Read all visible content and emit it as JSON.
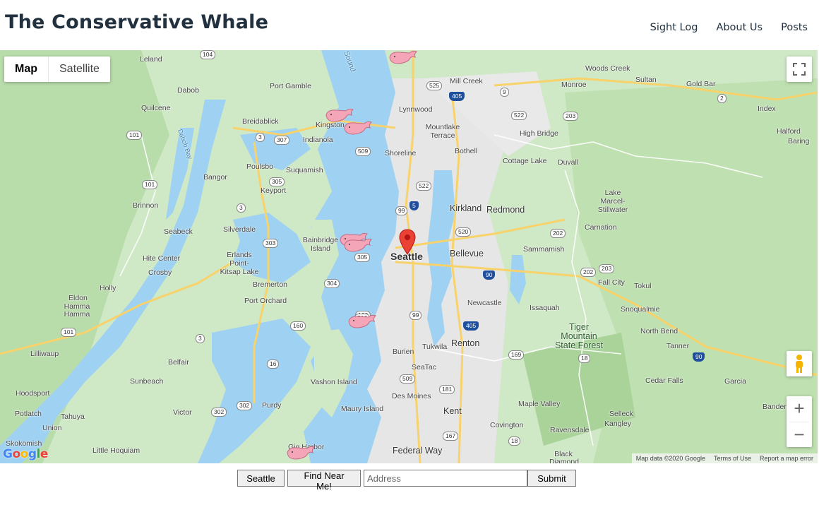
{
  "header": {
    "title": "The Conservative Whale",
    "nav": [
      "Sight Log",
      "About Us",
      "Posts"
    ]
  },
  "map": {
    "type_toggle": {
      "map": "Map",
      "satellite": "Satellite"
    },
    "marker_label": "Seattle",
    "places": {
      "leland": "Leland",
      "dabob": "Dabob",
      "quilcene": "Quilcene",
      "port_gamble": "Port Gamble",
      "breidablick": "Breidablick",
      "kingston": "Kingston",
      "lynnwood": "Lynnwood",
      "mountlake_terrace": "Mountlake Terrace",
      "mill_creek": "Mill Creek",
      "woods_creek": "Woods Creek",
      "sultan": "Sultan",
      "gold_bar": "Gold Bar",
      "monroe": "Monroe",
      "index": "Index",
      "halford": "Halford",
      "baring": "Baring",
      "high_bridge": "High Bridge",
      "bothell": "Bothell",
      "shoreline": "Shoreline",
      "indianola": "Indianola",
      "poulsbo": "Poulsbo",
      "suquamish": "Suquamish",
      "cottage_lake": "Cottage Lake",
      "duvall": "Duvall",
      "bangor": "Bangor",
      "keyport": "Keyport",
      "brinnon": "Brinnon",
      "kirkland": "Kirkland",
      "redmond": "Redmond",
      "lake_marcel": "Lake Marcel-Stillwater",
      "seabeck": "Seabeck",
      "silverdale": "Silverdale",
      "bainbridge_island": "Bainbridge Island",
      "carnation": "Carnation",
      "bellevue": "Bellevue",
      "sammamish": "Sammamish",
      "hite_center": "Hite Center",
      "erlands_point": "Erlands Point-Kitsap Lake",
      "crosby": "Crosby",
      "bremerton": "Bremerton",
      "fall_city": "Fall City",
      "tokul": "Tokul",
      "holly": "Holly",
      "eldon": "Eldon",
      "hamma_hamma": "Hamma Hamma",
      "port_orchard": "Port Orchard",
      "newcastle": "Newcastle",
      "issaquah": "Issaquah",
      "snoqualmie": "Snoqualmie",
      "tiger_mountain": "Tiger Mountain State Forest",
      "north_bend": "North Bend",
      "tanner": "Tanner",
      "lilliwaup": "Lilliwaup",
      "belfair": "Belfair",
      "burien": "Burien",
      "tukwila": "Tukwila",
      "renton": "Renton",
      "seatac": "SeaTac",
      "vashon_island": "Vashon Island",
      "cedar_falls": "Cedar Falls",
      "garcia": "Garcia",
      "hoodsport": "Hoodsport",
      "sunbeach": "Sunbeach",
      "des_moines": "Des Moines",
      "maple_valley": "Maple Valley",
      "potlatch": "Potlatch",
      "tahuya": "Tahuya",
      "victor": "Victor",
      "purdy": "Purdy",
      "maury_island": "Maury Island",
      "kent": "Kent",
      "covington": "Covington",
      "selleck": "Selleck",
      "kangley": "Kangley",
      "bander": "Bander",
      "union": "Union",
      "ravensdale": "Ravensdale",
      "skokomish": "Skokomish",
      "little_hoquiam": "Little Hoquiam",
      "gig_harbor": "Gig Harbor",
      "federal_way": "Federal Way",
      "black_diamond": "Black Diamond",
      "sound": "Sound",
      "dabob_bay": "Dabob Bay"
    },
    "routes": [
      "104",
      "525",
      "9",
      "405",
      "522",
      "203",
      "2",
      "101",
      "3",
      "307",
      "305",
      "522",
      "99",
      "5",
      "520",
      "202",
      "101",
      "3",
      "303",
      "305",
      "304",
      "90",
      "202",
      "203",
      "160",
      "160",
      "99",
      "405",
      "101",
      "3",
      "16",
      "169",
      "18",
      "90",
      "509",
      "181",
      "302",
      "302",
      "167",
      "18",
      "516",
      "509"
    ],
    "attribution": {
      "data": "Map data ©2020 Google",
      "terms": "Terms of Use",
      "report": "Report a map error"
    },
    "google_logo": "Google"
  },
  "form": {
    "seattle_button": "Seattle",
    "near_me_button": "Find Near Me!",
    "address_placeholder": "Address",
    "submit_button": "Submit"
  },
  "colors": {
    "water": "#9fd2f2",
    "land": "#cfe8c6",
    "forest": "#b6d9a8",
    "urban": "#e8e8e8",
    "road": "#f8d26a",
    "marker": "#ea4335",
    "whale": "#f4a5b8"
  },
  "icons": {
    "fullscreen": "fullscreen-icon",
    "pegman": "pegman-icon",
    "zoom_in": "plus-icon",
    "zoom_out": "minus-icon",
    "marker": "map-pin-icon",
    "whale": "whale-icon"
  }
}
